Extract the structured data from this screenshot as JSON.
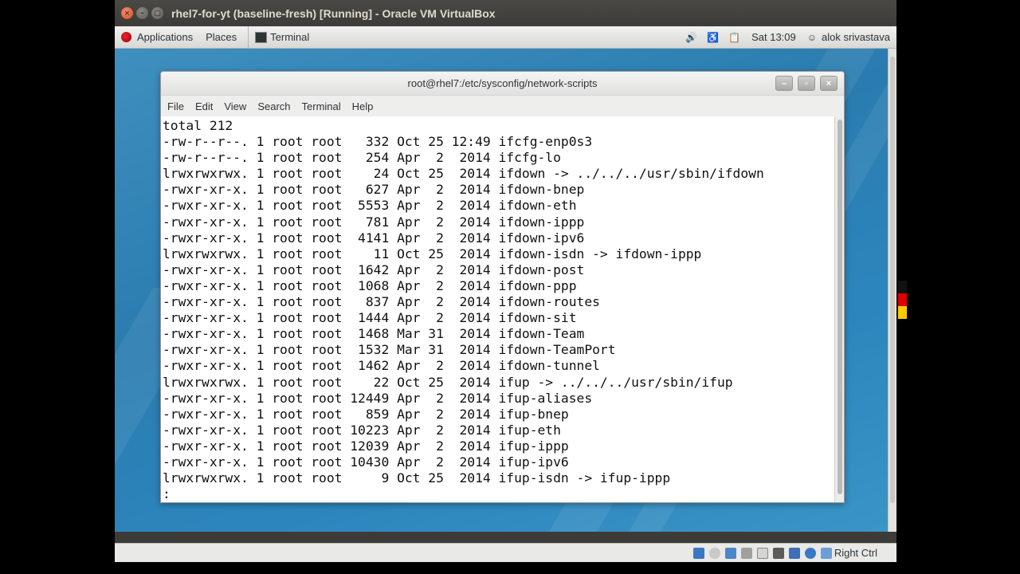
{
  "vbox": {
    "title": "rhel7-for-yt (baseline-fresh) [Running] - Oracle VM VirtualBox",
    "close_label": "×",
    "min_label": "–",
    "max_label": "□",
    "status": {
      "host_key": "Right Ctrl"
    }
  },
  "panel": {
    "applications": "Applications",
    "places": "Places",
    "terminal_task": "Terminal",
    "clock": "Sat 13:09",
    "user": "alok srivastava"
  },
  "terminal": {
    "title": "root@rhel7:/etc/sysconfig/network-scripts",
    "menu": [
      "File",
      "Edit",
      "View",
      "Search",
      "Terminal",
      "Help"
    ],
    "buttons": {
      "min": "–",
      "max": "▫",
      "close": "×"
    },
    "lines": [
      "total 212",
      "-rw-r--r--. 1 root root   332 Oct 25 12:49 ifcfg-enp0s3",
      "-rw-r--r--. 1 root root   254 Apr  2  2014 ifcfg-lo",
      "lrwxrwxrwx. 1 root root    24 Oct 25  2014 ifdown -> ../../../usr/sbin/ifdown",
      "-rwxr-xr-x. 1 root root   627 Apr  2  2014 ifdown-bnep",
      "-rwxr-xr-x. 1 root root  5553 Apr  2  2014 ifdown-eth",
      "-rwxr-xr-x. 1 root root   781 Apr  2  2014 ifdown-ippp",
      "-rwxr-xr-x. 1 root root  4141 Apr  2  2014 ifdown-ipv6",
      "lrwxrwxrwx. 1 root root    11 Oct 25  2014 ifdown-isdn -> ifdown-ippp",
      "-rwxr-xr-x. 1 root root  1642 Apr  2  2014 ifdown-post",
      "-rwxr-xr-x. 1 root root  1068 Apr  2  2014 ifdown-ppp",
      "-rwxr-xr-x. 1 root root   837 Apr  2  2014 ifdown-routes",
      "-rwxr-xr-x. 1 root root  1444 Apr  2  2014 ifdown-sit",
      "-rwxr-xr-x. 1 root root  1468 Mar 31  2014 ifdown-Team",
      "-rwxr-xr-x. 1 root root  1532 Mar 31  2014 ifdown-TeamPort",
      "-rwxr-xr-x. 1 root root  1462 Apr  2  2014 ifdown-tunnel",
      "lrwxrwxrwx. 1 root root    22 Oct 25  2014 ifup -> ../../../usr/sbin/ifup",
      "-rwxr-xr-x. 1 root root 12449 Apr  2  2014 ifup-aliases",
      "-rwxr-xr-x. 1 root root   859 Apr  2  2014 ifup-bnep",
      "-rwxr-xr-x. 1 root root 10223 Apr  2  2014 ifup-eth",
      "-rwxr-xr-x. 1 root root 12039 Apr  2  2014 ifup-ippp",
      "-rwxr-xr-x. 1 root root 10430 Apr  2  2014 ifup-ipv6",
      "lrwxrwxrwx. 1 root root     9 Oct 25  2014 ifup-isdn -> ifup-ippp",
      ":"
    ]
  },
  "colors": {
    "desktop_blue": "#2a7cb0",
    "vbox_title_bg": "#3c3b37",
    "close_orange": "#d94a22"
  },
  "icons": [
    "apps-icon",
    "terminal-icon",
    "volume-icon",
    "accessibility-icon",
    "clipboard-icon",
    "user-icon"
  ]
}
